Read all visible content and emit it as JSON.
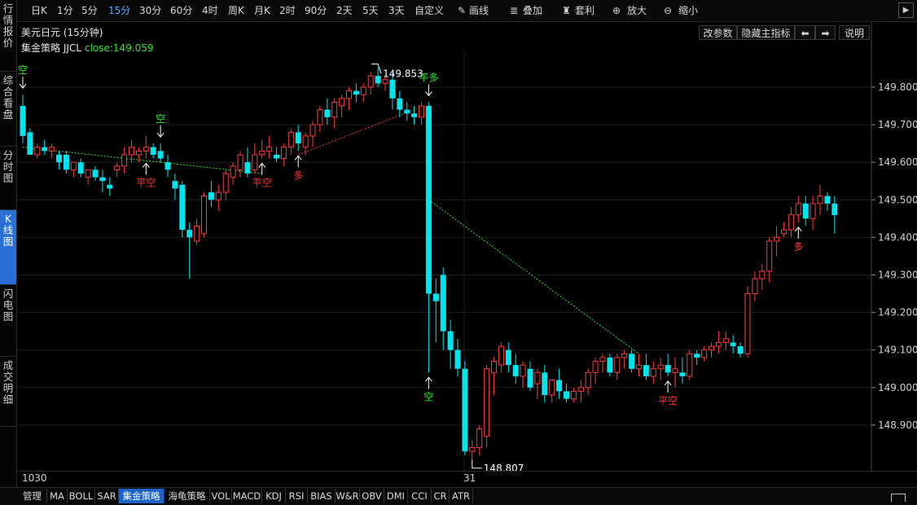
{
  "toolbar": {
    "periods": [
      "日K",
      "1分",
      "5分",
      "15分",
      "30分",
      "60分",
      "4时",
      "周K",
      "月K",
      "2时",
      "90分",
      "2天",
      "5天",
      "3天",
      "自定义"
    ],
    "active_period": "15分",
    "draw_label": "画线",
    "overlay_label": "叠加",
    "arbitrage_label": "套利",
    "zoom_in_label": "放大",
    "zoom_out_label": "缩小"
  },
  "sidebar": {
    "items": [
      "行情报价",
      "综合看盘",
      "分时图",
      "K线图",
      "闪电图",
      "成交明细"
    ],
    "active": "K线图"
  },
  "chart_header": {
    "title": "美元日元 (15分钟)",
    "strategy_name": "集金策略 JJCL",
    "close_text": "close:149.059",
    "buttons": [
      "改参数",
      "隐藏主指标",
      "⬅",
      "➡",
      "说明"
    ]
  },
  "chart_data": {
    "type": "candlestick",
    "ylim": [
      148.77,
      149.9
    ],
    "y_ticks": [
      "149.800",
      "149.700",
      "149.600",
      "149.500",
      "149.400",
      "149.300",
      "149.200",
      "149.100",
      "149.000",
      "148.900"
    ],
    "x_labels": [
      "1030",
      "31"
    ],
    "max_label": "149.853",
    "min_label": "148.807",
    "candles": [
      [
        149.75,
        149.78,
        149.65,
        149.67
      ],
      [
        149.68,
        149.69,
        149.62,
        149.62
      ],
      [
        149.62,
        149.65,
        149.61,
        149.64
      ],
      [
        149.64,
        149.66,
        149.62,
        149.63
      ],
      [
        149.63,
        149.65,
        149.61,
        149.64
      ],
      [
        149.62,
        149.63,
        149.58,
        149.6
      ],
      [
        149.62,
        149.63,
        149.57,
        149.58
      ],
      [
        149.58,
        149.6,
        149.56,
        149.6
      ],
      [
        149.6,
        149.61,
        149.56,
        149.57
      ],
      [
        149.56,
        149.58,
        149.54,
        149.58
      ],
      [
        149.58,
        149.59,
        149.55,
        149.56
      ],
      [
        149.56,
        149.58,
        149.52,
        149.55
      ],
      [
        149.54,
        149.56,
        149.51,
        149.53
      ],
      [
        149.58,
        149.6,
        149.56,
        149.59
      ],
      [
        149.59,
        149.64,
        149.57,
        149.62
      ],
      [
        149.62,
        149.66,
        149.6,
        149.64
      ],
      [
        149.62,
        149.64,
        149.6,
        149.63
      ],
      [
        149.63,
        149.67,
        149.61,
        149.64
      ],
      [
        149.64,
        149.65,
        149.61,
        149.62
      ],
      [
        149.63,
        149.65,
        149.6,
        149.61
      ],
      [
        149.6,
        149.62,
        149.56,
        149.58
      ],
      [
        149.55,
        149.57,
        149.5,
        149.53
      ],
      [
        149.54,
        149.55,
        149.4,
        149.42
      ],
      [
        149.42,
        149.44,
        149.29,
        149.4
      ],
      [
        149.39,
        149.45,
        149.38,
        149.43
      ],
      [
        149.41,
        149.52,
        149.4,
        149.51
      ],
      [
        149.52,
        149.55,
        149.48,
        149.5
      ],
      [
        149.5,
        149.54,
        149.47,
        149.52
      ],
      [
        149.52,
        149.58,
        149.5,
        149.57
      ],
      [
        149.56,
        149.6,
        149.54,
        149.59
      ],
      [
        149.58,
        149.63,
        149.56,
        149.62
      ],
      [
        149.6,
        149.64,
        149.56,
        149.57
      ],
      [
        149.58,
        149.65,
        149.57,
        149.62
      ],
      [
        149.62,
        149.66,
        149.61,
        149.63
      ],
      [
        149.63,
        149.67,
        149.61,
        149.64
      ],
      [
        149.62,
        149.64,
        149.6,
        149.61
      ],
      [
        149.61,
        149.65,
        149.59,
        149.64
      ],
      [
        149.64,
        149.69,
        149.62,
        149.68
      ],
      [
        149.68,
        149.7,
        149.63,
        149.65
      ],
      [
        149.64,
        149.68,
        149.62,
        149.67
      ],
      [
        149.67,
        149.71,
        149.64,
        149.7
      ],
      [
        149.7,
        149.75,
        149.68,
        149.74
      ],
      [
        149.74,
        149.77,
        149.7,
        149.72
      ],
      [
        149.72,
        149.77,
        149.69,
        149.76
      ],
      [
        149.75,
        149.78,
        149.72,
        149.77
      ],
      [
        149.77,
        149.8,
        149.74,
        149.79
      ],
      [
        149.79,
        149.81,
        149.76,
        149.78
      ],
      [
        149.78,
        149.81,
        149.76,
        149.8
      ],
      [
        149.8,
        149.84,
        149.78,
        149.83
      ],
      [
        149.83,
        149.853,
        149.8,
        149.81
      ],
      [
        149.81,
        149.83,
        149.79,
        149.82
      ],
      [
        149.82,
        149.84,
        149.74,
        149.77
      ],
      [
        149.77,
        149.79,
        149.72,
        149.74
      ],
      [
        149.74,
        149.76,
        149.71,
        149.73
      ],
      [
        149.73,
        149.75,
        149.7,
        149.72
      ],
      [
        149.72,
        149.76,
        149.7,
        149.75
      ],
      [
        149.75,
        149.76,
        149.04,
        149.25
      ],
      [
        149.25,
        149.29,
        149.12,
        149.23
      ],
      [
        149.3,
        149.32,
        149.1,
        149.15
      ],
      [
        149.15,
        149.18,
        149.05,
        149.1
      ],
      [
        149.1,
        149.13,
        149.03,
        149.05
      ],
      [
        149.05,
        149.07,
        148.82,
        148.83
      ],
      [
        148.83,
        148.86,
        148.807,
        148.84
      ],
      [
        148.84,
        148.9,
        148.82,
        148.89
      ],
      [
        148.87,
        149.06,
        148.84,
        149.05
      ],
      [
        149.04,
        149.08,
        148.98,
        149.07
      ],
      [
        149.06,
        149.12,
        149.04,
        149.11
      ],
      [
        149.1,
        149.12,
        149.04,
        149.06
      ],
      [
        149.06,
        149.09,
        149.01,
        149.03
      ],
      [
        149.03,
        149.07,
        149.0,
        149.06
      ],
      [
        149.05,
        149.07,
        148.99,
        149.0
      ],
      [
        149.01,
        149.05,
        148.97,
        149.04
      ],
      [
        149.04,
        149.06,
        148.96,
        148.98
      ],
      [
        148.98,
        149.02,
        148.96,
        149.02
      ],
      [
        149.02,
        149.05,
        148.97,
        148.99
      ],
      [
        148.99,
        149.01,
        148.96,
        148.97
      ],
      [
        148.97,
        149.0,
        148.96,
        148.99
      ],
      [
        148.99,
        149.02,
        148.96,
        149.0
      ],
      [
        149.0,
        149.05,
        148.98,
        149.04
      ],
      [
        149.04,
        149.08,
        149.01,
        149.07
      ],
      [
        149.07,
        149.09,
        149.04,
        149.08
      ],
      [
        149.08,
        149.09,
        149.03,
        149.04
      ],
      [
        149.04,
        149.09,
        149.02,
        149.08
      ],
      [
        149.08,
        149.1,
        149.05,
        149.09
      ],
      [
        149.09,
        149.1,
        149.04,
        149.05
      ],
      [
        149.05,
        149.09,
        149.03,
        149.06
      ],
      [
        149.06,
        149.09,
        149.02,
        149.03
      ],
      [
        149.03,
        149.07,
        149.01,
        149.05
      ],
      [
        149.05,
        149.08,
        149.02,
        149.06
      ],
      [
        149.06,
        149.09,
        149.03,
        149.04
      ],
      [
        149.04,
        149.08,
        149.0,
        149.05
      ],
      [
        149.04,
        149.08,
        149.01,
        149.03
      ],
      [
        149.03,
        149.1,
        149.02,
        149.09
      ],
      [
        149.09,
        149.1,
        149.06,
        149.08
      ],
      [
        149.08,
        149.11,
        149.07,
        149.1
      ],
      [
        149.1,
        149.12,
        149.08,
        149.11
      ],
      [
        149.11,
        149.15,
        149.09,
        149.12
      ],
      [
        149.12,
        149.15,
        149.1,
        149.13
      ],
      [
        149.12,
        149.14,
        149.09,
        149.11
      ],
      [
        149.11,
        149.12,
        149.08,
        149.09
      ],
      [
        149.09,
        149.27,
        149.08,
        149.25
      ],
      [
        149.25,
        149.31,
        149.23,
        149.29
      ],
      [
        149.29,
        149.33,
        149.26,
        149.31
      ],
      [
        149.31,
        149.4,
        149.28,
        149.39
      ],
      [
        149.39,
        149.43,
        149.35,
        149.4
      ],
      [
        149.41,
        149.44,
        149.4,
        149.42
      ],
      [
        149.42,
        149.48,
        149.4,
        149.46
      ],
      [
        149.46,
        149.51,
        149.44,
        149.49
      ],
      [
        149.49,
        149.51,
        149.43,
        149.45
      ],
      [
        149.45,
        149.51,
        149.42,
        149.49
      ],
      [
        149.49,
        149.54,
        149.46,
        149.51
      ],
      [
        149.51,
        149.52,
        149.47,
        149.49
      ],
      [
        149.49,
        149.51,
        149.41,
        149.459
      ]
    ],
    "signals": [
      {
        "idx": 0,
        "label": "空",
        "pos": "above",
        "color": "#2ee82e"
      },
      {
        "idx": 17,
        "label": "平空",
        "pos": "below",
        "color": "#ff3030"
      },
      {
        "idx": 19,
        "label": "空",
        "pos": "above",
        "color": "#2ee82e"
      },
      {
        "idx": 33,
        "label": "平空",
        "pos": "below",
        "color": "#ff3030"
      },
      {
        "idx": 38,
        "label": "多",
        "pos": "below",
        "color": "#ff3030"
      },
      {
        "idx": 56,
        "label": "平多",
        "pos": "above",
        "color": "#2ee82e"
      },
      {
        "idx": 56,
        "label": "空",
        "pos": "belowlow",
        "color": "#2ee82e"
      },
      {
        "idx": 89,
        "label": "平空",
        "pos": "below",
        "color": "#ff3030"
      },
      {
        "idx": 107,
        "label": "多",
        "pos": "below",
        "color": "#ff3030"
      }
    ],
    "trend_lines": [
      {
        "from": [
          0,
          149.64
        ],
        "to": [
          19,
          149.6
        ],
        "color": "#2ee82e"
      },
      {
        "from": [
          19,
          149.6
        ],
        "to": [
          33,
          149.57
        ],
        "color": "#2ee82e"
      },
      {
        "from": [
          38,
          149.62
        ],
        "to": [
          54,
          149.74
        ],
        "color": "#ff3030"
      },
      {
        "from": [
          56,
          149.5
        ],
        "to": [
          85,
          149.09
        ],
        "color": "#2ee82e"
      }
    ],
    "colors": {
      "up": "#ff3b3b",
      "down": "#00e5ee",
      "grid": "#1f1f1f",
      "axis_text": "#d0d0d0"
    }
  },
  "indicators": {
    "items": [
      "管理",
      "MA",
      "BOLL",
      "SAR",
      "集金策略",
      "海龟策略",
      "VOL",
      "MACD",
      "KDJ",
      "RSI",
      "BIAS",
      "W&R",
      "OBV",
      "DMI",
      "CCI",
      "CR",
      "ATR"
    ],
    "active": "集金策略"
  }
}
